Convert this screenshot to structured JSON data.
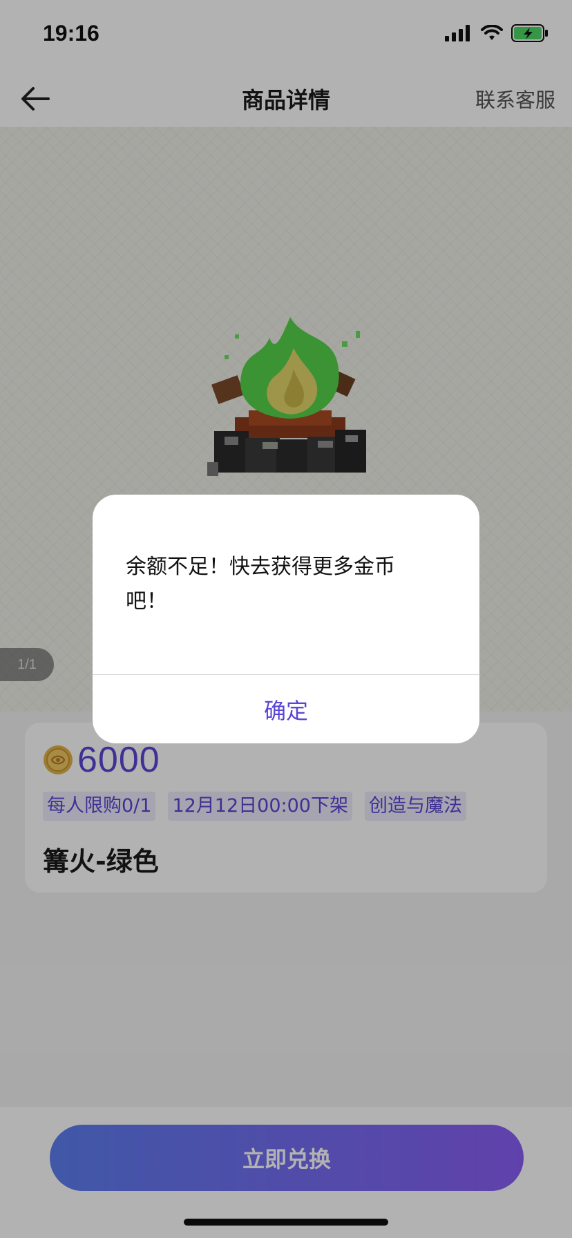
{
  "status_bar": {
    "time": "19:16"
  },
  "nav": {
    "title": "商品详情",
    "contact_label": "联系客服"
  },
  "gallery": {
    "counter": "1/1"
  },
  "product": {
    "price": "6000",
    "tags": [
      "每人限购0/1",
      "12月12日00:00下架",
      "创造与魔法"
    ],
    "name": "篝火-绿色"
  },
  "bottom": {
    "redeem_label": "立即兑换"
  },
  "dialog": {
    "message": "余额不足！快去获得更多金币吧！",
    "confirm_label": "确定"
  },
  "colors": {
    "accent": "#5b45d6",
    "button_start": "#5d7ef0",
    "button_end": "#8a5ef5",
    "fire": "#55d34a"
  },
  "icons": {
    "back": "arrow-left-icon",
    "coin": "coin-icon",
    "signal": "signal-icon",
    "wifi": "wifi-icon",
    "battery": "battery-charging-icon"
  }
}
